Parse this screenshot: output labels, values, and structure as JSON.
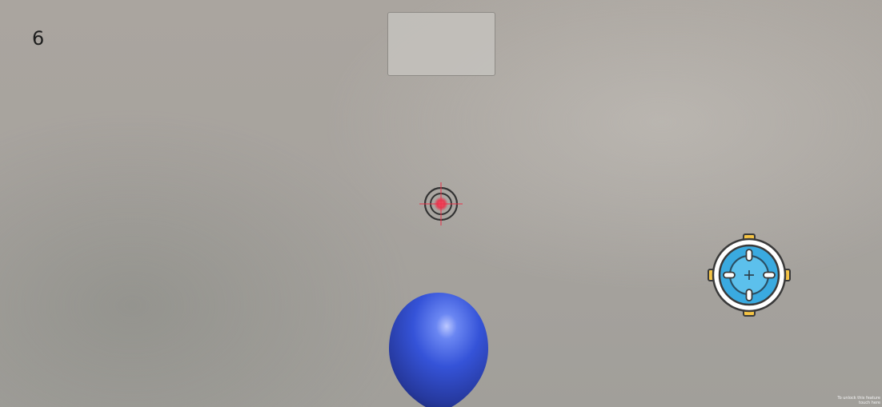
{
  "hud": {
    "score": "6"
  },
  "top_panel": {
    "label": ""
  },
  "fire_button": {
    "icon": "crosshair-target-icon",
    "colors": {
      "ring_outer": "#ffffff",
      "ring_fill": "#3aaae0",
      "accent": "#f5c445",
      "outline": "#3a3a3a"
    }
  },
  "crosshair": {
    "icon": "crosshair-reticle-icon",
    "colors": {
      "ring": "#333333",
      "center": "#e8324a"
    }
  },
  "balloon": {
    "color": "#3250d6"
  },
  "watermark": {
    "line1": "To unlock this feature",
    "line2": "touch here"
  }
}
